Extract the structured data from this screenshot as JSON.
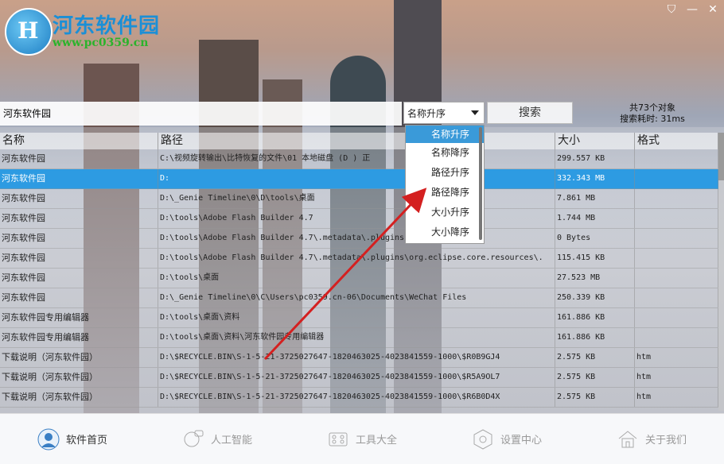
{
  "brand": {
    "name": "河东软件园",
    "url": "www.pc0359.cn",
    "logo_letter": "H"
  },
  "window": {
    "icons": [
      "shirt-icon",
      "minimize-icon",
      "close-icon"
    ],
    "min_glyph": "—",
    "close_glyph": "✕",
    "skin_glyph": "⛉"
  },
  "search": {
    "value": "河东软件园",
    "sort_selected": "名称升序",
    "button_label": "搜索"
  },
  "stats": {
    "count_text": "共73个对象",
    "time_text": "搜索耗时: 31ms"
  },
  "table": {
    "columns": [
      "名称",
      "路径",
      "大小",
      "格式"
    ],
    "rows": [
      {
        "name": "河东软件园",
        "path": "C:\\视频旋转输出\\比特恢复的文件\\01 本地磁盘 (D ) 正",
        "size": "299.557 KB",
        "format": ""
      },
      {
        "name": "河东软件园",
        "path": "D:",
        "size": "332.343 MB",
        "format": ""
      },
      {
        "name": "河东软件园",
        "path": "D:\\_Genie Timeline\\0\\D\\tools\\桌面",
        "size": "7.861 MB",
        "format": ""
      },
      {
        "name": "河东软件园",
        "path": "D:\\tools\\Adobe Flash Builder 4.7",
        "size": "1.744 MB",
        "format": ""
      },
      {
        "name": "河东软件园",
        "path": "D:\\tools\\Adobe Flash Builder 4.7\\.metadata\\.plugins",
        "size": "0 Bytes",
        "format": ""
      },
      {
        "name": "河东软件园",
        "path": "D:\\tools\\Adobe Flash Builder 4.7\\.metadata\\.plugins\\org.eclipse.core.resources\\.",
        "size": "115.415 KB",
        "format": ""
      },
      {
        "name": "河东软件园",
        "path": "D:\\tools\\桌面",
        "size": "27.523 MB",
        "format": ""
      },
      {
        "name": "河东软件园",
        "path": "D:\\_Genie Timeline\\0\\C\\Users\\pc0359.cn-06\\Documents\\WeChat Files",
        "size": "250.339 KB",
        "format": ""
      },
      {
        "name": "河东软件园专用编辑器",
        "path": "D:\\tools\\桌面\\资料",
        "size": "161.886 KB",
        "format": ""
      },
      {
        "name": "河东软件园专用编辑器",
        "path": "D:\\tools\\桌面\\资料\\河东软件园专用编辑器",
        "size": "161.886 KB",
        "format": ""
      },
      {
        "name": "下载说明（河东软件园）",
        "path": "D:\\$RECYCLE.BIN\\S-1-5-21-3725027647-1820463025-4023841559-1000\\$R0B9GJ4",
        "size": "2.575 KB",
        "format": "htm"
      },
      {
        "name": "下载说明（河东软件园）",
        "path": "D:\\$RECYCLE.BIN\\S-1-5-21-3725027647-1820463025-4023841559-1000\\$R5A9OL7",
        "size": "2.575 KB",
        "format": "htm"
      },
      {
        "name": "下载说明（河东软件园）",
        "path": "D:\\$RECYCLE.BIN\\S-1-5-21-3725027647-1820463025-4023841559-1000\\$R6B0D4X",
        "size": "2.575 KB",
        "format": "htm"
      }
    ]
  },
  "sort_menu": [
    "名称升序",
    "名称降序",
    "路径升序",
    "路径降序",
    "大小升序",
    "大小降序"
  ],
  "bottom_nav": [
    {
      "label": "软件首页",
      "icon": "user-headset-icon"
    },
    {
      "label": "人工智能",
      "icon": "ai-bot-icon"
    },
    {
      "label": "工具大全",
      "icon": "tools-grid-icon"
    },
    {
      "label": "设置中心",
      "icon": "settings-hex-icon"
    },
    {
      "label": "关于我们",
      "icon": "home-icon"
    }
  ],
  "colors": {
    "accent": "#2d9be2",
    "brand_blue": "#1b8fd6",
    "brand_green": "#2bb32b",
    "annotation_arrow": "#d42020"
  }
}
